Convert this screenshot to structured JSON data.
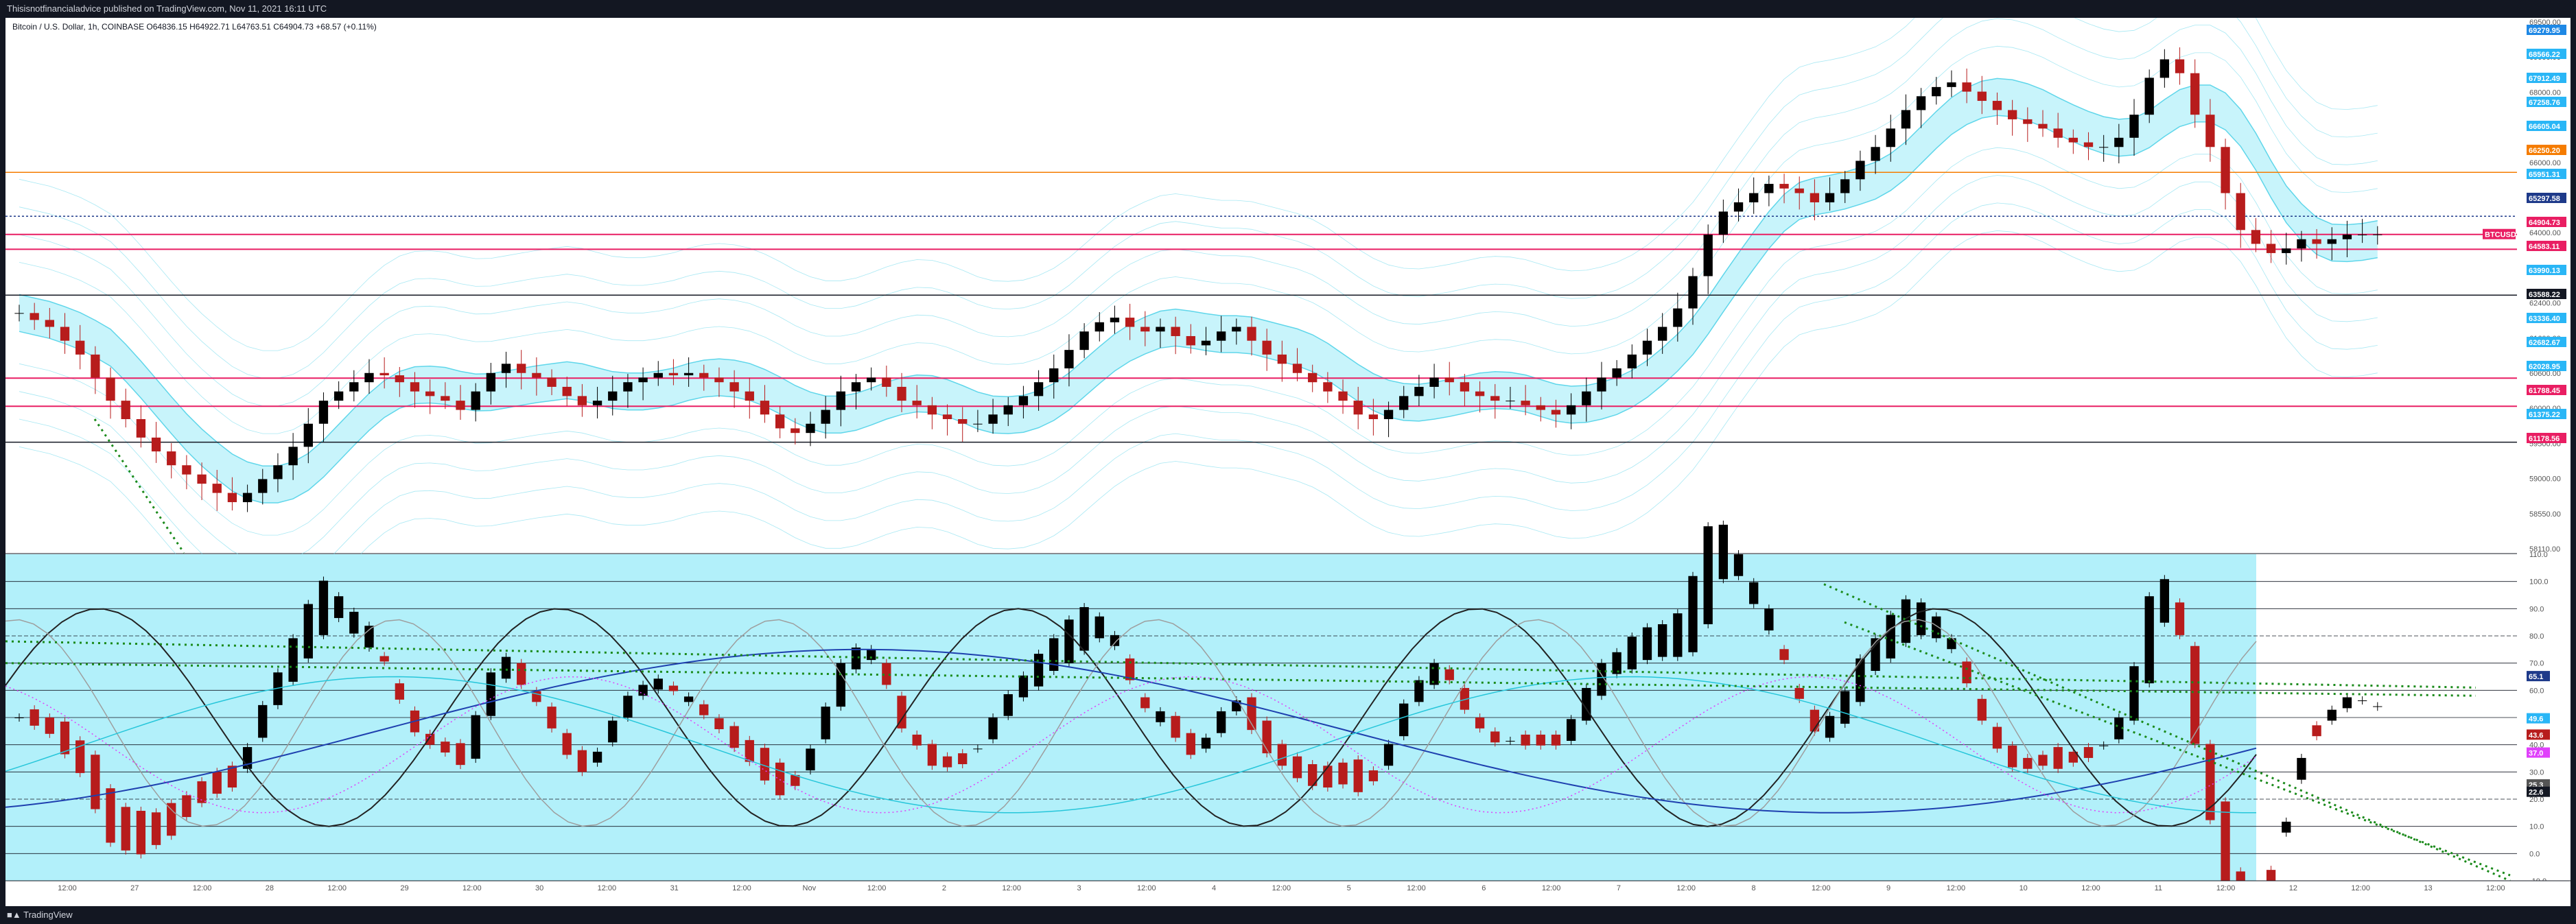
{
  "publisher_line": "Thisisnotfinancialadvice published on TradingView.com, Nov 11, 2021 16:11 UTC",
  "footer_brand": "TradingView",
  "symbol_line": "Bitcoin / U.S. Dollar, 1h, COINBASE  O64836.15  H64922.71  L64763.51  C64904.73  +68.57 (+0.11%)",
  "colors": {
    "up": "#000000",
    "down": "#b71c1c",
    "band_fill": "#c8f4fb",
    "band_line": "#5fd6ea",
    "orange_line": "#f57c00",
    "pink_line": "#e91e63",
    "blue_dotted": "#1e3a8a",
    "osc_bg": "#b2f0fa",
    "green_dotted": "#1b8a1b"
  },
  "chart_data": [
    {
      "type": "candlestick",
      "title": "Bitcoin / U.S. Dollar, 1h, COINBASE",
      "ylim": [
        58000,
        69600
      ],
      "y_ticks": [
        "69500.00",
        "69000.00",
        "68000.00",
        "67000.00",
        "66000.00",
        "65600.00",
        "64000.00",
        "63000.00",
        "62400.00",
        "61600.00",
        "60600.00",
        "60000.00",
        "59500.00",
        "59000.00",
        "58550.00",
        "58110.00"
      ],
      "x_ticks": [
        "12:00",
        "27",
        "12:00",
        "28",
        "12:00",
        "29",
        "12:00",
        "30",
        "12:00",
        "31",
        "12:00",
        "Nov",
        "12:00",
        "2",
        "12:00",
        "3",
        "12:00",
        "4",
        "12:00",
        "5",
        "12:00",
        "6",
        "12:00",
        "7",
        "12:00",
        "8",
        "12:00",
        "9",
        "12:00",
        "10",
        "12:00",
        "11",
        "12:00",
        "12",
        "12:00",
        "13",
        "12:00"
      ],
      "price_labels": [
        {
          "text": "69279.95",
          "color": "#1e88e5"
        },
        {
          "text": "68566.22",
          "color": "#29b6f6"
        },
        {
          "text": "67912.49",
          "color": "#29b6f6"
        },
        {
          "text": "67258.76",
          "color": "#29b6f6"
        },
        {
          "text": "66605.04",
          "color": "#29b6f6"
        },
        {
          "text": "66250.20",
          "color": "#f57c00"
        },
        {
          "text": "65951.31",
          "color": "#29b6f6"
        },
        {
          "text": "65297.58",
          "color": "#1e3a8a"
        },
        {
          "text": "64904.73",
          "color": "#e91e63"
        },
        {
          "text": "64583.11",
          "color": "#e91e63"
        },
        {
          "text": "63990.13",
          "color": "#29b6f6"
        },
        {
          "text": "63588.22",
          "color": "#131722"
        },
        {
          "text": "63336.40",
          "color": "#29b6f6"
        },
        {
          "text": "62682.67",
          "color": "#29b6f6"
        },
        {
          "text": "62028.95",
          "color": "#29b6f6"
        },
        {
          "text": "61788.45",
          "color": "#e91e63"
        },
        {
          "text": "61375.22",
          "color": "#29b6f6"
        },
        {
          "text": "61178.56",
          "color": "#e91e63"
        }
      ],
      "symbol_tag": "BTCUSD",
      "horizontal_levels": [
        {
          "price": 66250.2,
          "color": "#f57c00",
          "style": "solid"
        },
        {
          "price": 65297.58,
          "color": "#1e3a8a",
          "style": "dotted"
        },
        {
          "price": 64904.73,
          "color": "#e91e63",
          "style": "solid"
        },
        {
          "price": 64583.11,
          "color": "#e91e63",
          "style": "solid"
        },
        {
          "price": 63588.22,
          "color": "#131722",
          "style": "solid"
        },
        {
          "price": 61788.45,
          "color": "#e91e63",
          "style": "solid"
        },
        {
          "price": 61178.56,
          "color": "#e91e63",
          "style": "solid"
        },
        {
          "price": 60400,
          "color": "#131722",
          "style": "solid"
        }
      ],
      "series": [
        {
          "name": "BTCUSD",
          "close": [
            63200,
            63050,
            62900,
            62600,
            62300,
            61800,
            61300,
            60900,
            60500,
            60200,
            59900,
            59700,
            59500,
            59300,
            59100,
            59300,
            59600,
            59900,
            60300,
            60800,
            61300,
            61500,
            61700,
            61900,
            61850,
            61700,
            61500,
            61400,
            61300,
            61100,
            61500,
            61900,
            62100,
            61900,
            61800,
            61600,
            61400,
            61200,
            61300,
            61500,
            61700,
            61800,
            61900,
            61850,
            61900,
            61800,
            61700,
            61500,
            61300,
            61000,
            60700,
            60600,
            60800,
            61100,
            61500,
            61700,
            61800,
            61600,
            61300,
            61200,
            61000,
            60900,
            60800,
            60800,
            61000,
            61200,
            61400,
            61700,
            62000,
            62400,
            62800,
            63000,
            63100,
            62900,
            62800,
            62900,
            62700,
            62500,
            62600,
            62800,
            62900,
            62600,
            62300,
            62100,
            61900,
            61700,
            61500,
            61300,
            61000,
            60900,
            61100,
            61400,
            61600,
            61800,
            61700,
            61500,
            61400,
            61300,
            61300,
            61200,
            61100,
            61000,
            61200,
            61500,
            61800,
            62000,
            62300,
            62600,
            62900,
            63300,
            64000,
            64900,
            65400,
            65600,
            65800,
            66000,
            65900,
            65800,
            65600,
            65800,
            66100,
            66500,
            66800,
            67200,
            67600,
            67900,
            68100,
            68200,
            68000,
            67800,
            67600,
            67400,
            67300,
            67200,
            67000,
            66900,
            66800,
            66800,
            67000,
            67500,
            68300,
            68700,
            68400,
            67500,
            66800,
            65800,
            65000,
            64700,
            64500,
            64600,
            64800,
            64700,
            64800,
            64900,
            64900,
            64904
          ]
        }
      ]
    },
    {
      "type": "line",
      "title": "Oscillators",
      "ylim": [
        -10,
        110
      ],
      "y_ticks": [
        "110.0",
        "100.0",
        "90.0",
        "80.0",
        "70.0",
        "60.0",
        "50.0",
        "40.0",
        "30.0",
        "20.0",
        "10.0",
        "0.0",
        "-10.0"
      ],
      "value_labels": [
        {
          "text": "65.1",
          "color": "#1e3a8a"
        },
        {
          "text": "49.6",
          "color": "#29b6f6"
        },
        {
          "text": "43.6",
          "color": "#b71c1c"
        },
        {
          "text": "37.0",
          "color": "#e040fb"
        },
        {
          "text": "25.3",
          "color": "#555555"
        },
        {
          "text": "22.6",
          "color": "#131722"
        }
      ]
    }
  ]
}
